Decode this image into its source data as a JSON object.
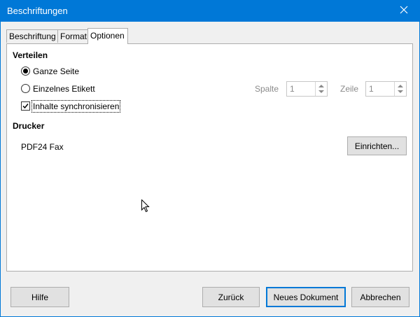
{
  "window": {
    "title": "Beschriftungen",
    "close_icon": "close-icon"
  },
  "tabs": [
    {
      "label": "Beschriftung",
      "active": false
    },
    {
      "label": "Format",
      "active": false
    },
    {
      "label": "Optionen",
      "active": true
    }
  ],
  "verteilen": {
    "heading": "Verteilen",
    "ganze_seite": "Ganze Seite",
    "einzelnes_etikett": "Einzelnes Etikett",
    "inhalte_sync": "Inhalte synchronisieren",
    "spalte_label": "Spalte",
    "spalte_value": "1",
    "zeile_label": "Zeile",
    "zeile_value": "1"
  },
  "drucker": {
    "heading": "Drucker",
    "printer_name": "PDF24 Fax",
    "einrichten_button": "Einrichten..."
  },
  "buttons": {
    "hilfe": "Hilfe",
    "zurueck": "Zurück",
    "neues_dokument": "Neues Dokument",
    "abbrechen": "Abbrechen"
  },
  "state": {
    "ganze_seite_selected": true,
    "inhalte_sync_checked": true
  }
}
